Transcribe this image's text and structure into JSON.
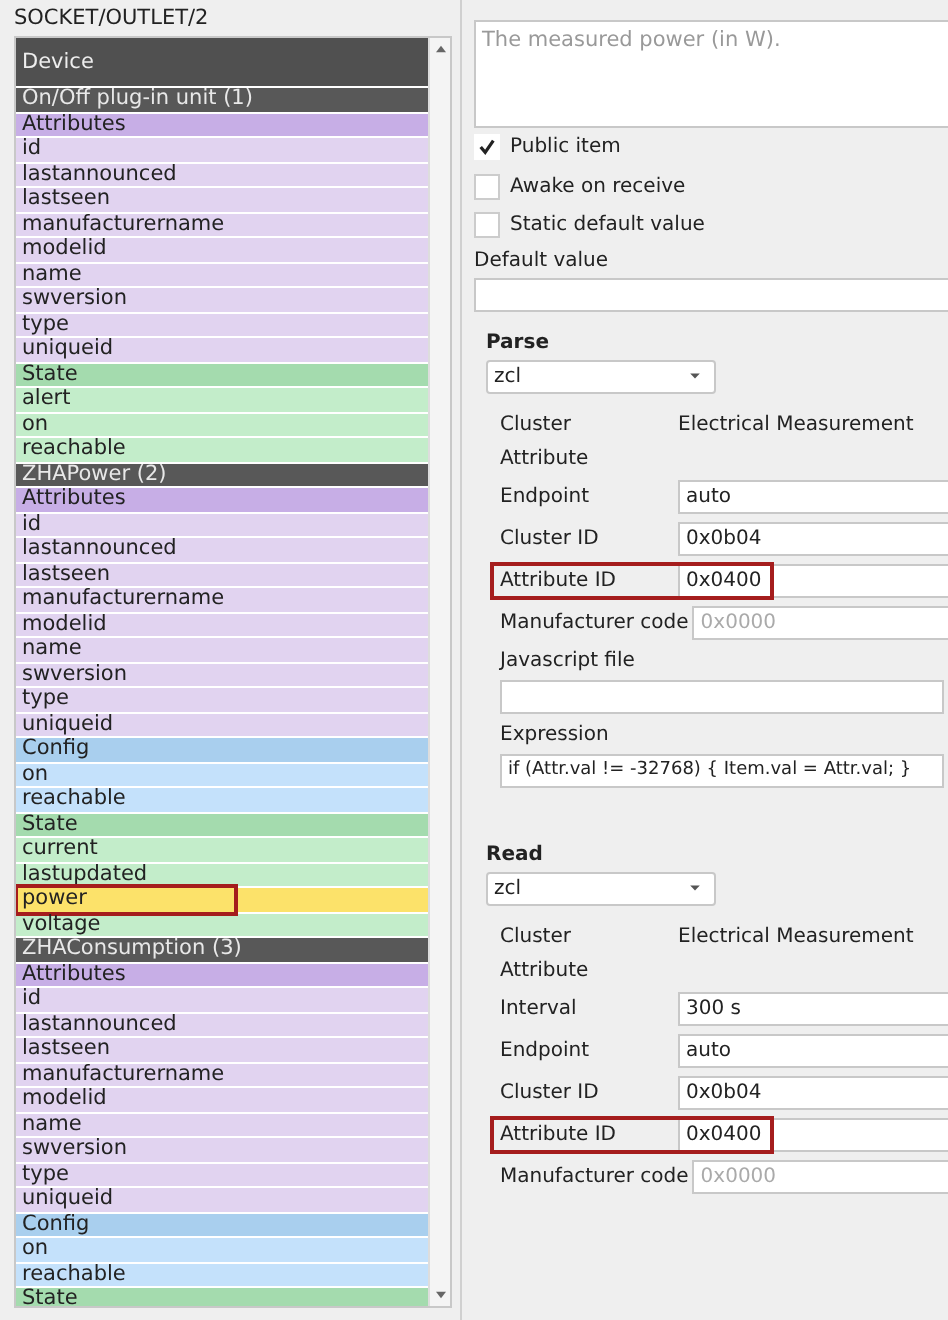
{
  "left_panel": {
    "title": "SOCKET/OUTLET/2",
    "tree": {
      "header": "Device",
      "clusters": [
        {
          "label": "On/Off plug-in unit (1)",
          "groups": [
            {
              "label": "Attributes",
              "kind": "attributes",
              "children": [
                {
                  "label": "id",
                  "selected": false
                },
                {
                  "label": "lastannounced",
                  "selected": false
                },
                {
                  "label": "lastseen",
                  "selected": false
                },
                {
                  "label": "manufacturername",
                  "selected": false
                },
                {
                  "label": "modelid",
                  "selected": false
                },
                {
                  "label": "name",
                  "selected": false
                },
                {
                  "label": "swversion",
                  "selected": false
                },
                {
                  "label": "type",
                  "selected": false
                },
                {
                  "label": "uniqueid",
                  "selected": false
                }
              ]
            },
            {
              "label": "State",
              "kind": "state",
              "children": [
                {
                  "label": "alert",
                  "selected": false
                },
                {
                  "label": "on",
                  "selected": false
                },
                {
                  "label": "reachable",
                  "selected": false
                }
              ]
            }
          ]
        },
        {
          "label": "ZHAPower (2)",
          "groups": [
            {
              "label": "Attributes",
              "kind": "attributes",
              "children": [
                {
                  "label": "id",
                  "selected": false
                },
                {
                  "label": "lastannounced",
                  "selected": false
                },
                {
                  "label": "lastseen",
                  "selected": false
                },
                {
                  "label": "manufacturername",
                  "selected": false
                },
                {
                  "label": "modelid",
                  "selected": false
                },
                {
                  "label": "name",
                  "selected": false
                },
                {
                  "label": "swversion",
                  "selected": false
                },
                {
                  "label": "type",
                  "selected": false
                },
                {
                  "label": "uniqueid",
                  "selected": false
                }
              ]
            },
            {
              "label": "Config",
              "kind": "config",
              "children": [
                {
                  "label": "on",
                  "selected": false
                },
                {
                  "label": "reachable",
                  "selected": false
                }
              ]
            },
            {
              "label": "State",
              "kind": "state",
              "children": [
                {
                  "label": "current",
                  "selected": false
                },
                {
                  "label": "lastupdated",
                  "selected": false
                },
                {
                  "label": "power",
                  "selected": true
                },
                {
                  "label": "voltage",
                  "selected": false
                }
              ]
            }
          ]
        },
        {
          "label": "ZHAConsumption (3)",
          "groups": [
            {
              "label": "Attributes",
              "kind": "attributes",
              "children": [
                {
                  "label": "id",
                  "selected": false
                },
                {
                  "label": "lastannounced",
                  "selected": false
                },
                {
                  "label": "lastseen",
                  "selected": false
                },
                {
                  "label": "manufacturername",
                  "selected": false
                },
                {
                  "label": "modelid",
                  "selected": false
                },
                {
                  "label": "name",
                  "selected": false
                },
                {
                  "label": "swversion",
                  "selected": false
                },
                {
                  "label": "type",
                  "selected": false
                },
                {
                  "label": "uniqueid",
                  "selected": false
                }
              ]
            },
            {
              "label": "Config",
              "kind": "config",
              "children": [
                {
                  "label": "on",
                  "selected": false
                },
                {
                  "label": "reachable",
                  "selected": false
                }
              ]
            },
            {
              "label": "State",
              "kind": "state"
            }
          ]
        }
      ]
    }
  },
  "right_panel": {
    "description": {
      "placeholder": "The measured power (in W)."
    },
    "checkboxes": [
      {
        "label": "Public item",
        "checked": true
      },
      {
        "label": "Awake on receive",
        "checked": false
      },
      {
        "label": "Static default value",
        "checked": false
      }
    ],
    "default_value": {
      "label": "Default value"
    },
    "sections": [
      {
        "title": "Parse",
        "dropdown": "zcl",
        "rows": [
          {
            "kind": "text",
            "label": "Cluster",
            "value": "Electrical Measurement"
          },
          {
            "kind": "text",
            "label": "Attribute"
          },
          {
            "kind": "field",
            "label": "Endpoint",
            "value": "auto",
            "highlighted": false
          },
          {
            "kind": "field",
            "label": "Cluster ID",
            "value": "0x0b04",
            "highlighted": false
          },
          {
            "kind": "field",
            "label": "Attribute ID",
            "value": "0x0400",
            "highlighted": true
          },
          {
            "kind": "field",
            "label": "Manufacturer code",
            "placeholder": "0x0000",
            "highlighted": false
          },
          {
            "kind": "stacked",
            "label": "Javascript file"
          },
          {
            "kind": "stacked",
            "label": "Expression",
            "value": "if (Attr.val != -32768) { Item.val = Attr.val; }"
          }
        ]
      },
      {
        "title": "Read",
        "dropdown": "zcl",
        "rows": [
          {
            "kind": "text",
            "label": "Cluster",
            "value": "Electrical Measurement"
          },
          {
            "kind": "text",
            "label": "Attribute"
          },
          {
            "kind": "field",
            "label": "Interval",
            "value": "300 s",
            "highlighted": false
          },
          {
            "kind": "field",
            "label": "Endpoint",
            "value": "auto",
            "highlighted": false
          },
          {
            "kind": "field",
            "label": "Cluster ID",
            "value": "0x0b04",
            "highlighted": false
          },
          {
            "kind": "field",
            "label": "Attribute ID",
            "value": "0x0400",
            "highlighted": true
          },
          {
            "kind": "field",
            "label": "Manufacturer code",
            "placeholder": "0x0000",
            "highlighted": false
          }
        ]
      }
    ]
  }
}
